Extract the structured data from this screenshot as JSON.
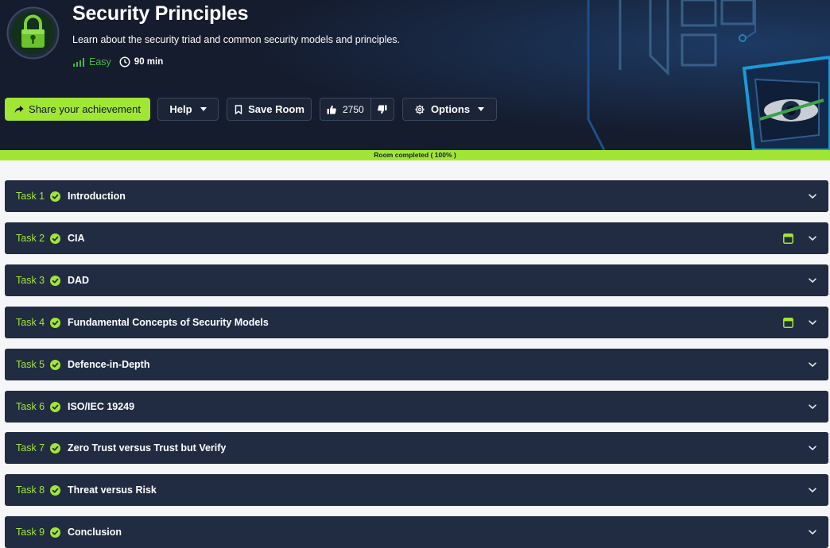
{
  "room": {
    "title": "Security Principles",
    "description": "Learn about the security triad and common security models and principles.",
    "difficulty": "Easy",
    "duration": "90 min"
  },
  "actions": {
    "share_label": "Share your achievement",
    "help_label": "Help",
    "save_label": "Save Room",
    "like_count": "2750",
    "options_label": "Options"
  },
  "progress": {
    "label": "Room completed ( 100% )",
    "percent": 100
  },
  "tasks": [
    {
      "label": "Task 1",
      "title": "Introduction",
      "has_calc": false
    },
    {
      "label": "Task 2",
      "title": "CIA",
      "has_calc": true
    },
    {
      "label": "Task 3",
      "title": "DAD",
      "has_calc": false
    },
    {
      "label": "Task 4",
      "title": "Fundamental Concepts of Security Models",
      "has_calc": true
    },
    {
      "label": "Task 5",
      "title": "Defence-in-Depth",
      "has_calc": false
    },
    {
      "label": "Task 6",
      "title": "ISO/IEC 19249",
      "has_calc": false
    },
    {
      "label": "Task 7",
      "title": "Zero Trust versus Trust but Verify",
      "has_calc": false
    },
    {
      "label": "Task 8",
      "title": "Threat versus Risk",
      "has_calc": false
    },
    {
      "label": "Task 9",
      "title": "Conclusion",
      "has_calc": false
    }
  ],
  "colors": {
    "accent": "#a2e635",
    "hero_bg": "#151c2e",
    "task_bg": "#212c42",
    "difficulty": "#43b843"
  },
  "icons": {
    "room": "padlock-icon",
    "difficulty": "signal-bars-icon",
    "duration": "clock-icon",
    "share": "share-arrow-icon",
    "save": "bookmark-icon",
    "like": "thumbs-up-icon",
    "dislike": "thumbs-down-icon",
    "options": "gear-icon",
    "task_done": "check-circle-icon",
    "task_calc": "calculator-icon",
    "expand": "chevron-down-icon"
  }
}
